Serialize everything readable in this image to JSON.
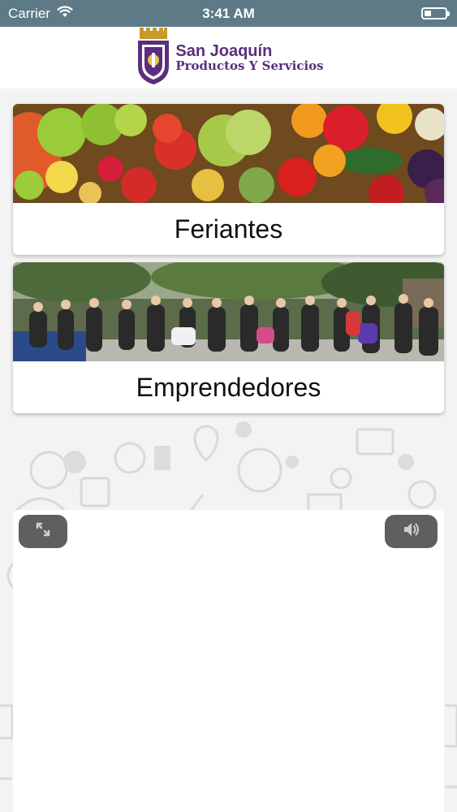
{
  "status_bar": {
    "carrier": "Carrier",
    "time": "3:41 AM",
    "wifi_icon": "wifi-icon",
    "battery_icon": "battery-icon"
  },
  "header": {
    "title": "San Joaquín",
    "subtitle": "Productos Y Servicios",
    "logo_icon": "municipal-crest-icon",
    "brand_color": "#5b2e7c"
  },
  "cards": [
    {
      "label": "Feriantes",
      "image": "fruits-vegetables-photo"
    },
    {
      "label": "Emprendedores",
      "image": "group-photo"
    }
  ],
  "video": {
    "expand_icon": "expand-icon",
    "sound_icon": "speaker-icon"
  },
  "colors": {
    "status_bar_bg": "#5d7a86",
    "button_bg": "#5f5f5f"
  }
}
